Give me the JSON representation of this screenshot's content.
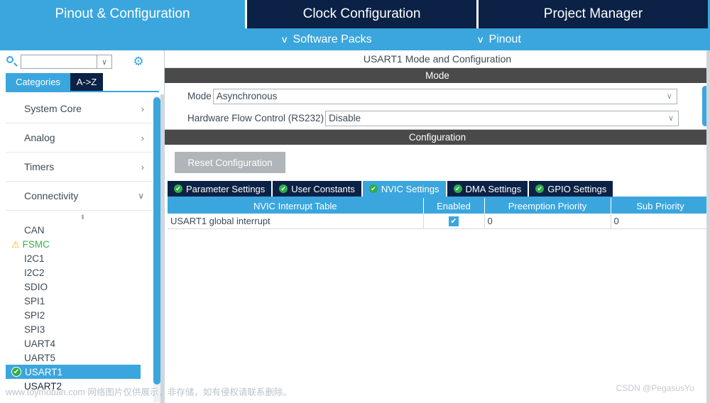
{
  "main_tabs": [
    {
      "label": "Pinout & Configuration",
      "active": true
    },
    {
      "label": "Clock Configuration",
      "active": false
    },
    {
      "label": "Project Manager",
      "active": false
    }
  ],
  "sub_bar": {
    "software_packs": "Software Packs",
    "pinout": "Pinout",
    "chevron": "∨"
  },
  "sidebar": {
    "search": {
      "value": "",
      "placeholder": ""
    },
    "view_tabs": [
      {
        "label": "Categories",
        "active": true
      },
      {
        "label": "A->Z",
        "active": false
      }
    ],
    "categories": [
      {
        "label": "System Core",
        "expanded": false,
        "arrow": "›"
      },
      {
        "label": "Analog",
        "expanded": false,
        "arrow": "›"
      },
      {
        "label": "Timers",
        "expanded": false,
        "arrow": "›"
      },
      {
        "label": "Connectivity",
        "expanded": true,
        "arrow": "∨"
      }
    ],
    "peripherals": [
      {
        "label": "CAN",
        "state": "normal"
      },
      {
        "label": "FSMC",
        "state": "warning"
      },
      {
        "label": "I2C1",
        "state": "normal"
      },
      {
        "label": "I2C2",
        "state": "normal"
      },
      {
        "label": "SDIO",
        "state": "normal"
      },
      {
        "label": "SPI1",
        "state": "normal"
      },
      {
        "label": "SPI2",
        "state": "normal"
      },
      {
        "label": "SPI3",
        "state": "normal"
      },
      {
        "label": "UART4",
        "state": "normal"
      },
      {
        "label": "UART5",
        "state": "normal"
      },
      {
        "label": "USART1",
        "state": "selected"
      },
      {
        "label": "USART2",
        "state": "normal"
      }
    ]
  },
  "panel": {
    "title": "USART1 Mode and Configuration",
    "mode_section_label": "Mode",
    "config_section_label": "Configuration",
    "fields": [
      {
        "label": "Mode",
        "value": "Asynchronous"
      },
      {
        "label": "Hardware Flow Control (RS232)",
        "value": "Disable"
      }
    ],
    "reset_button": "Reset Configuration",
    "config_tabs": [
      {
        "label": "Parameter Settings",
        "active": false
      },
      {
        "label": "User Constants",
        "active": false
      },
      {
        "label": "NVIC Settings",
        "active": true
      },
      {
        "label": "DMA Settings",
        "active": false
      },
      {
        "label": "GPIO Settings",
        "active": false
      }
    ],
    "nvic_table": {
      "headers": [
        "NVIC Interrupt Table",
        "Enabled",
        "Preemption Priority",
        "Sub Priority"
      ],
      "rows": [
        {
          "name": "USART1 global interrupt",
          "enabled": true,
          "preemption_priority": "0",
          "sub_priority": "0"
        }
      ]
    }
  },
  "watermarks": {
    "left": "www.toymoban.com 网络图片仅供展示，非存储，如有侵权请联系删除。",
    "right": "CSDN @PegasusYu"
  },
  "colors": {
    "accent_blue": "#3ba6dd",
    "navy": "#0b2145",
    "section_gray": "#4a4a4a",
    "green": "#2fad4a",
    "warning_yellow": "#f0b400"
  },
  "glyphs": {
    "check": "✔",
    "warning": "⚠",
    "chevron_down": "∨",
    "chevron_right": "›",
    "gear": "⚙",
    "spinner": "⬍"
  }
}
